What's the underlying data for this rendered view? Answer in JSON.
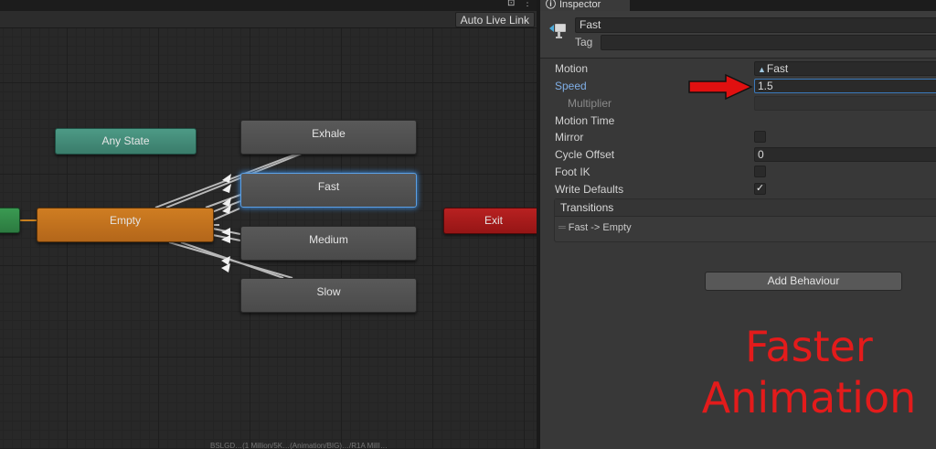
{
  "graph": {
    "toolbar": {
      "auto_live_link_label": "Auto Live Link"
    },
    "states": {
      "any_state": "Any State",
      "empty": "Empty",
      "exit": "Exit",
      "exhale": "Exhale",
      "fast": "Fast",
      "medium": "Medium",
      "slow": "Slow"
    },
    "selected_state": "Fast",
    "status_text": "BSLGD…(1 Million/5K…(Animation/BIG)…/R1A MillI…"
  },
  "inspector": {
    "tab_label": "Inspector",
    "name_value": "Fast",
    "tag_label": "Tag",
    "tag_value": "",
    "properties": {
      "motion_label": "Motion",
      "motion_value": "Fast",
      "speed_label": "Speed",
      "speed_value": "1.5",
      "multiplier_label": "Multiplier",
      "motion_time_label": "Motion Time",
      "mirror_label": "Mirror",
      "mirror_checked": false,
      "cycle_offset_label": "Cycle Offset",
      "cycle_offset_value": "0",
      "foot_ik_label": "Foot IK",
      "foot_ik_checked": false,
      "write_defaults_label": "Write Defaults",
      "write_defaults_checked": true,
      "write_defaults_mark": "✓"
    },
    "transitions": {
      "title": "Transitions",
      "items": [
        "Fast -> Empty"
      ]
    },
    "add_behaviour_label": "Add Behaviour"
  },
  "annotation": {
    "line1": "Faster",
    "line2": "Animation",
    "color": "#e31b1b"
  },
  "colors": {
    "any_state": "#4d9a86",
    "empty_state": "#cf7d22",
    "exit_state": "#b82121",
    "entry_state": "#3a9a52",
    "selection": "#5aa0e6"
  }
}
